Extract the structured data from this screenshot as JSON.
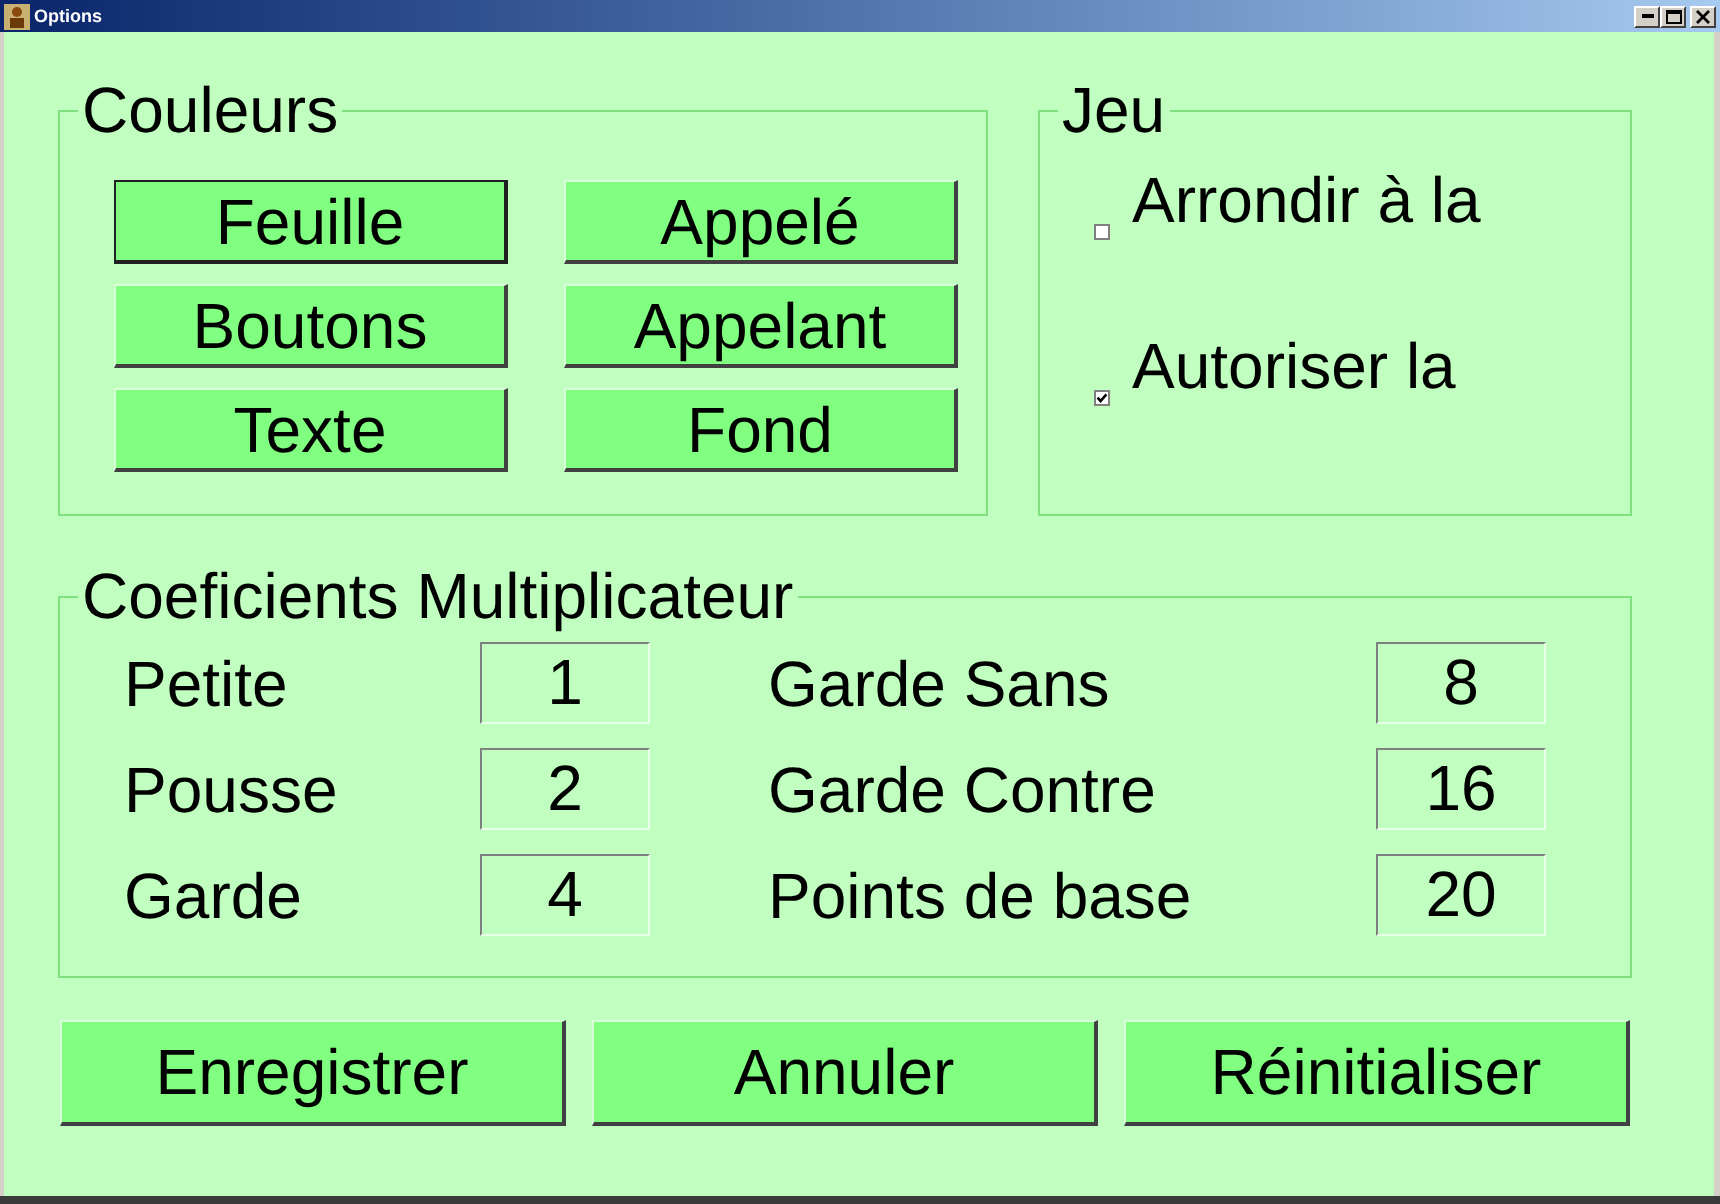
{
  "window": {
    "title": "Options"
  },
  "colors_group": {
    "title": "Couleurs",
    "buttons": [
      {
        "label": "Feuille",
        "focused": true
      },
      {
        "label": "Appelé",
        "focused": false
      },
      {
        "label": "Boutons",
        "focused": false
      },
      {
        "label": "Appelant",
        "focused": false
      },
      {
        "label": "Texte",
        "focused": false
      },
      {
        "label": "Fond",
        "focused": false
      }
    ]
  },
  "game_group": {
    "title": "Jeu",
    "options": [
      {
        "label": "Arrondir à la",
        "checked": false
      },
      {
        "label": "Autoriser la",
        "checked": true
      }
    ]
  },
  "coefficients_group": {
    "title": "Coeficients Multiplicateur",
    "fields": [
      {
        "label": "Petite",
        "value": "1"
      },
      {
        "label": "Garde Sans",
        "value": "8"
      },
      {
        "label": "Pousse",
        "value": "2"
      },
      {
        "label": "Garde Contre",
        "value": "16"
      },
      {
        "label": "Garde",
        "value": "4"
      },
      {
        "label": "Points de base",
        "value": "20"
      }
    ]
  },
  "buttons": [
    "Enregistrer",
    "Annuler",
    "Réinitialiser"
  ]
}
